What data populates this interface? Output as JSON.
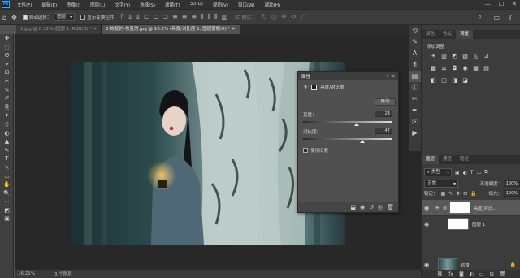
{
  "app": {
    "logo": "Ps"
  },
  "menu": [
    "文件(F)",
    "编辑(E)",
    "图像(I)",
    "图层(L)",
    "文字(Y)",
    "选择(S)",
    "滤镜(T)",
    "3D(D)",
    "视图(V)",
    "窗口(W)",
    "帮助(H)"
  ],
  "window_controls": [
    "—",
    "☐",
    "✕"
  ],
  "options": {
    "auto_select_label": "自动选择：",
    "auto_select_value": "图层",
    "show_transform_label": "显示变换控件",
    "mode_3d_label": "3D 模式："
  },
  "tabs": [
    {
      "label": "1.jpg @ 8.32% (图层 1, RGB/8) *",
      "active": false
    },
    {
      "label": "2-恢复的-恢复的.jpg @ 16.2% (亮度/对比度 1, 图层蒙版/8) *",
      "active": true
    }
  ],
  "tools": [
    "✥",
    "⬚",
    "ʘ",
    "⌖",
    "⊡",
    "✂",
    "✎",
    "✐",
    "⎘",
    "✦",
    "⬯",
    "◐",
    "▲",
    "✎",
    "T",
    "↖",
    "▭",
    "✋",
    "🔍",
    "⋯",
    "◩",
    "▣"
  ],
  "properties": {
    "title": "属性",
    "adjustment_name": "亮度/对比度",
    "auto_button": "自动",
    "brightness_label": "亮度：",
    "brightness_value": "24",
    "brightness_level": 0.6,
    "contrast_label": "对比度：",
    "contrast_value": "47",
    "contrast_level": 0.66,
    "legacy_label": "使用旧版",
    "legacy_checked": false
  },
  "status": {
    "zoom": "16.21%",
    "info": "3 个图层"
  },
  "adjust_panel": {
    "tabs": [
      "颜色",
      "色板",
      "调整"
    ],
    "active_tab": 2,
    "add_label": "添加调整",
    "icons": [
      "☀",
      "▥",
      "◩",
      "▧",
      "◬",
      "⊿",
      "▩",
      "⚖",
      "◘",
      "◉",
      "▦",
      "▤",
      "◧",
      "◫",
      "◨",
      "◪"
    ]
  },
  "layers_panel": {
    "tabs": [
      "图层",
      "通道",
      "路径"
    ],
    "active_tab": 0,
    "filter_kind": "类型",
    "blend_mode": "正常",
    "opacity_label": "不透明度：",
    "opacity_value": "100%",
    "lock_label": "锁定：",
    "fill_label": "填充：",
    "fill_value": "100%",
    "layers": [
      {
        "name": "亮度/对比... ",
        "kind": "adjustment",
        "thumb_icon": "☀"
      },
      {
        "name": "图层 1",
        "kind": "white"
      },
      {
        "name": "背景",
        "kind": "photo"
      }
    ],
    "footer_icons": [
      "⛓",
      "fx",
      "◙",
      "◐",
      "▭",
      "⊞",
      "🗑"
    ]
  },
  "colors": {
    "accent": "#31a8ff",
    "panel": "#3c3c3c",
    "canvas": "#282828"
  }
}
